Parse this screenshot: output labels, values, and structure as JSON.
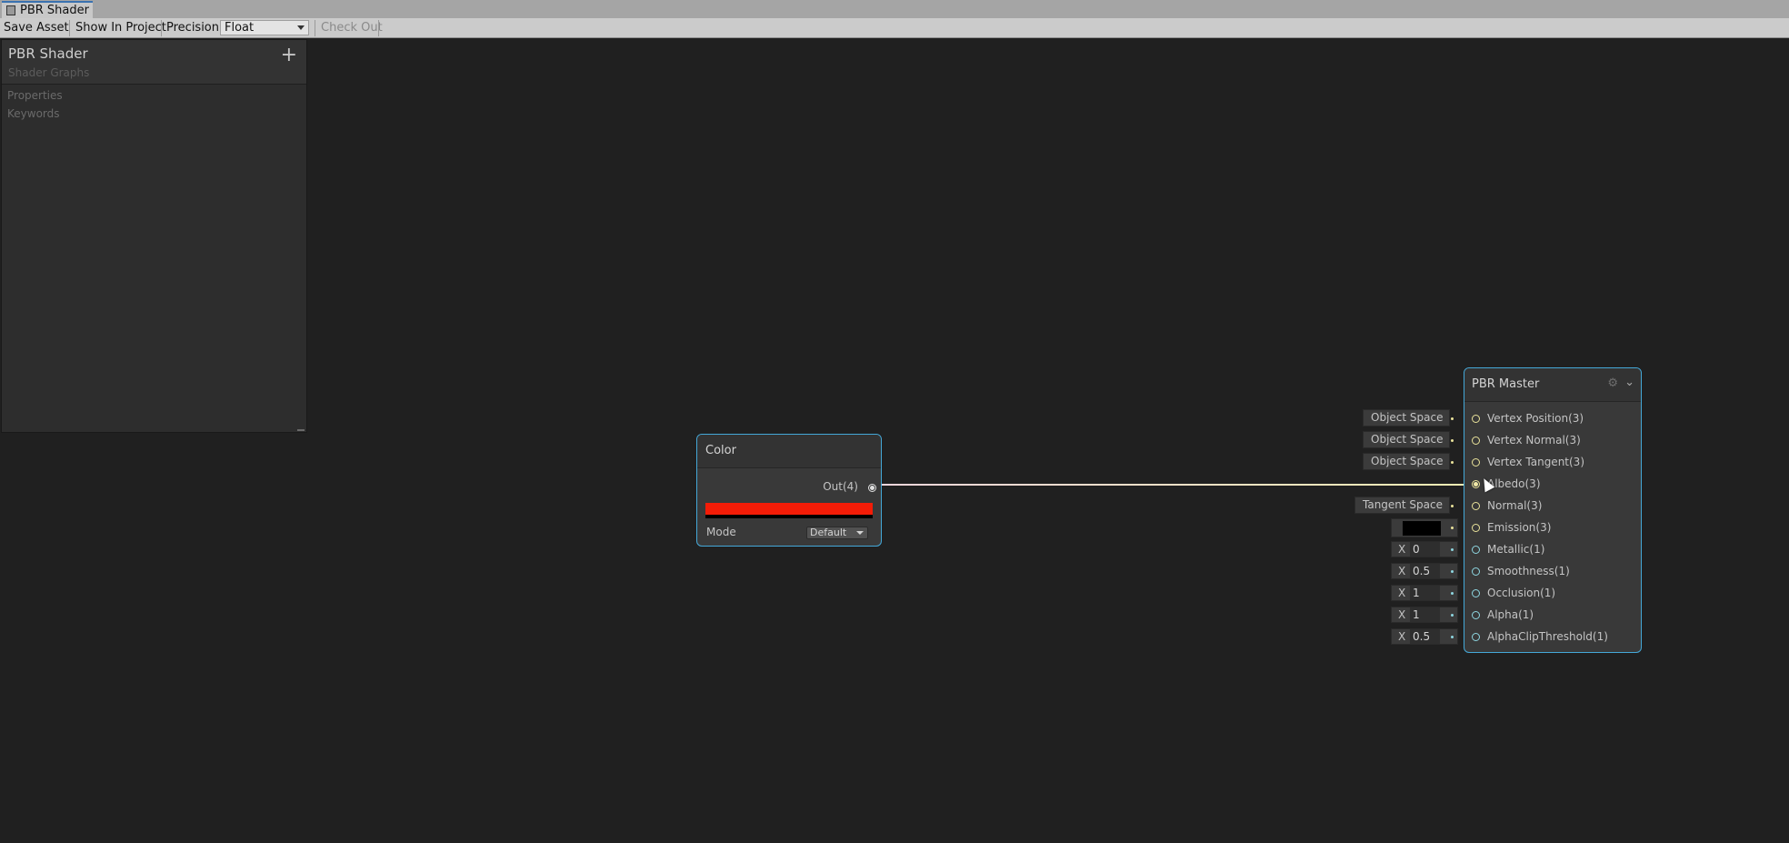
{
  "window": {
    "tab_title": "PBR Shader",
    "tab_icon": "shader-graph-icon"
  },
  "toolbar": {
    "save_asset": "Save Asset",
    "show_in_project": "Show In Project",
    "precision_label": "Precision",
    "precision_value": "Float",
    "check_out": "Check Out"
  },
  "blackboard": {
    "title": "PBR Shader",
    "subtitle": "Shader Graphs",
    "add_icon": "+",
    "sections": [
      "Properties",
      "Keywords"
    ]
  },
  "color_node": {
    "title": "Color",
    "output_label": "Out(4)",
    "color_value": "#f41c07",
    "mode_label": "Mode",
    "mode_value": "Default"
  },
  "pbr_master": {
    "title": "PBR Master",
    "slots": [
      "Vertex Position(3)",
      "Vertex Normal(3)",
      "Vertex Tangent(3)",
      "Albedo(3)",
      "Normal(3)",
      "Emission(3)",
      "Metallic(1)",
      "Smoothness(1)",
      "Occlusion(1)",
      "Alpha(1)",
      "AlphaClipThreshold(1)"
    ],
    "inputs": {
      "vertex_position_space": "Object Space",
      "vertex_normal_space": "Object Space",
      "vertex_tangent_space": "Object Space",
      "normal_space": "Tangent Space",
      "emission_color": "#000000",
      "x_label": "X",
      "metallic": "0",
      "smoothness": "0.5",
      "occlusion": "1",
      "alpha": "1",
      "alpha_clip_threshold": "0.5"
    }
  },
  "colors": {
    "selection_border": "#44a8d8",
    "vector3_port": "#e9e29a",
    "vector1_port": "#8ed6e0"
  }
}
